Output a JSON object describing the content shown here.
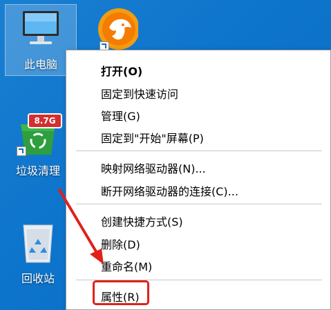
{
  "desktop": {
    "icons": [
      {
        "label": "此电脑",
        "icon": "computer-icon"
      },
      {
        "label": "",
        "icon": "cheetah-browser-icon"
      },
      {
        "label": "垃圾清理",
        "icon": "trash-cleaner-icon",
        "badge": "8.7G"
      },
      {
        "label": "回收站",
        "icon": "recycle-bin-icon"
      }
    ]
  },
  "context_menu": {
    "items": [
      {
        "label": "打开(O)",
        "bold": true
      },
      {
        "label": "固定到快速访问"
      },
      {
        "label": "管理(G)"
      },
      {
        "label": "固定到\"开始\"屏幕(P)"
      },
      {
        "label": "映射网络驱动器(N)..."
      },
      {
        "label": "断开网络驱动器的连接(C)..."
      },
      {
        "label": "创建快捷方式(S)"
      },
      {
        "label": "删除(D)"
      },
      {
        "label": "重命名(M)"
      },
      {
        "label": "属性(R)"
      }
    ]
  },
  "colors": {
    "desktop_bg": "#0d74cc",
    "highlight": "#e0201b",
    "badge_bg": "#d32f2f",
    "cleaner_green": "#2e9e3e"
  }
}
